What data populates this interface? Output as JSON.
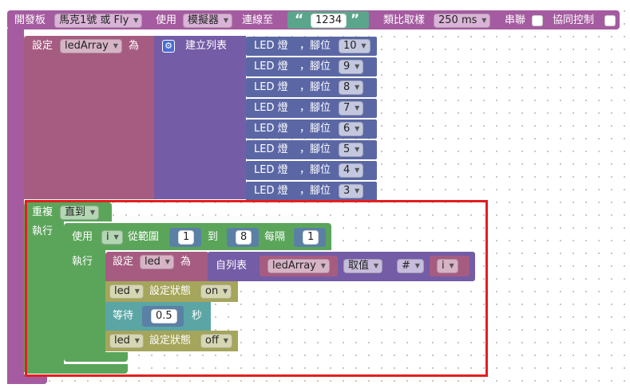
{
  "top_block": {
    "board_label": "開發板",
    "board_value": "馬克1號 或 Fly",
    "use_label": "使用",
    "use_value": "模擬器",
    "connect_label": "連線至",
    "connect_value": "1234",
    "analog_label": "類比取樣",
    "analog_value": "250 ms",
    "serial_label": "串聯",
    "sync_label": "協同控制"
  },
  "set_array": {
    "set_label": "設定",
    "var_name": "ledArray",
    "as_label": "為",
    "create_list_label": "建立列表",
    "items": [
      {
        "label": "LED 燈",
        "pin_label": "，腳位",
        "pin": "10"
      },
      {
        "label": "LED 燈",
        "pin_label": "，腳位",
        "pin": "9"
      },
      {
        "label": "LED 燈",
        "pin_label": "，腳位",
        "pin": "8"
      },
      {
        "label": "LED 燈",
        "pin_label": "，腳位",
        "pin": "7"
      },
      {
        "label": "LED 燈",
        "pin_label": "，腳位",
        "pin": "6"
      },
      {
        "label": "LED 燈",
        "pin_label": "，腳位",
        "pin": "5"
      },
      {
        "label": "LED 燈",
        "pin_label": "，腳位",
        "pin": "4"
      },
      {
        "label": "LED 燈",
        "pin_label": "，腳位",
        "pin": "3"
      }
    ]
  },
  "repeat_block": {
    "repeat_label": "重複",
    "mode": "直到",
    "do_label": "執行"
  },
  "for_block": {
    "use_label": "使用",
    "var": "i",
    "from_label": "從範圍",
    "from": "1",
    "to_label": "到",
    "to": "8",
    "step_label": "每隔",
    "step": "1",
    "do_label": "執行"
  },
  "set_led": {
    "set_label": "設定",
    "var": "led",
    "as_label": "為",
    "from_list_label": "自列表",
    "list_name": "ledArray",
    "get_label": "取值",
    "index_mode": "#",
    "index_var": "i"
  },
  "led_on": {
    "var": "led",
    "state_label": "設定狀態",
    "state": "on"
  },
  "wait": {
    "label": "等待",
    "value": "0.5",
    "unit": "秒"
  },
  "led_off": {
    "var": "led",
    "state_label": "設定狀態",
    "state": "off"
  },
  "colors": {
    "board": "#a55ba0",
    "variables": "#a65c81",
    "lists": "#745ca6",
    "led": "#5b67a5",
    "loops": "#5ba55b",
    "led_state": "#a5a55b",
    "wait": "#5ba5a5",
    "highlight": "#e41e1e"
  }
}
